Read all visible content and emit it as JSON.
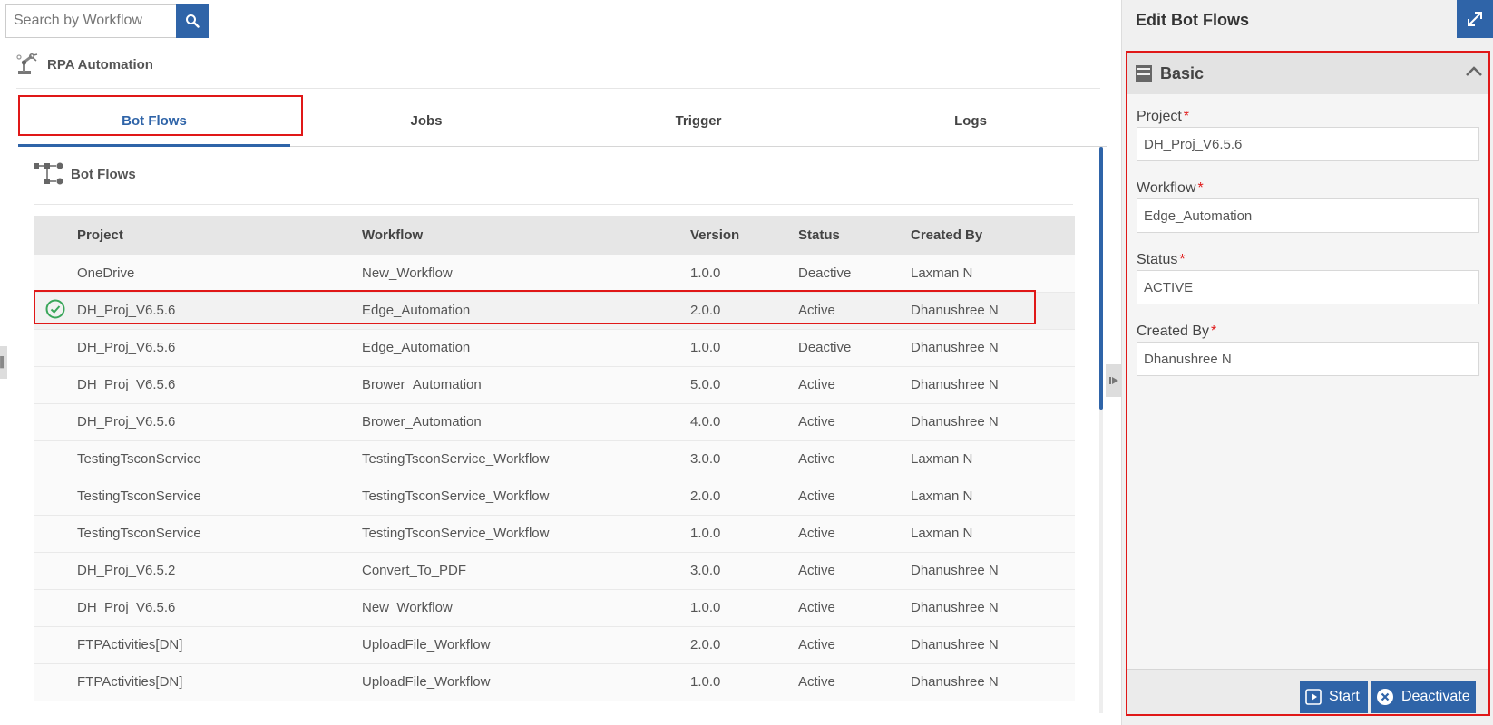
{
  "search": {
    "placeholder": "Search by Workflow"
  },
  "app": {
    "title": "RPA Automation"
  },
  "tabs": [
    {
      "label": "Bot Flows",
      "active": true
    },
    {
      "label": "Jobs"
    },
    {
      "label": "Trigger"
    },
    {
      "label": "Logs"
    }
  ],
  "section": {
    "title": "Bot Flows"
  },
  "table": {
    "headers": [
      "Project",
      "Workflow",
      "Version",
      "Status",
      "Created By"
    ],
    "rows": [
      [
        "OneDrive",
        "New_Workflow",
        "1.0.0",
        "Deactive",
        "Laxman N"
      ],
      [
        "DH_Proj_V6.5.6",
        "Edge_Automation",
        "2.0.0",
        "Active",
        "Dhanushree N"
      ],
      [
        "DH_Proj_V6.5.6",
        "Edge_Automation",
        "1.0.0",
        "Deactive",
        "Dhanushree N"
      ],
      [
        "DH_Proj_V6.5.6",
        "Brower_Automation",
        "5.0.0",
        "Active",
        "Dhanushree N"
      ],
      [
        "DH_Proj_V6.5.6",
        "Brower_Automation",
        "4.0.0",
        "Active",
        "Dhanushree N"
      ],
      [
        "TestingTsconService",
        "TestingTsconService_Workflow",
        "3.0.0",
        "Active",
        "Laxman N"
      ],
      [
        "TestingTsconService",
        "TestingTsconService_Workflow",
        "2.0.0",
        "Active",
        "Laxman N"
      ],
      [
        "TestingTsconService",
        "TestingTsconService_Workflow",
        "1.0.0",
        "Active",
        "Laxman N"
      ],
      [
        "DH_Proj_V6.5.2",
        "Convert_To_PDF",
        "3.0.0",
        "Active",
        "Dhanushree N"
      ],
      [
        "DH_Proj_V6.5.6",
        "New_Workflow",
        "1.0.0",
        "Active",
        "Dhanushree N"
      ],
      [
        "FTPActivities[DN]",
        "UploadFile_Workflow",
        "2.0.0",
        "Active",
        "Dhanushree N"
      ],
      [
        "FTPActivities[DN]",
        "UploadFile_Workflow",
        "1.0.0",
        "Active",
        "Dhanushree N"
      ]
    ],
    "selected_index": 1
  },
  "panel": {
    "title": "Edit Bot Flows",
    "section": "Basic",
    "fields": {
      "project": {
        "label": "Project",
        "value": "DH_Proj_V6.5.6"
      },
      "workflow": {
        "label": "Workflow",
        "value": "Edge_Automation"
      },
      "status": {
        "label": "Status",
        "value": "ACTIVE"
      },
      "created_by": {
        "label": "Created By",
        "value": "Dhanushree N"
      }
    },
    "start_label": "Start",
    "deactivate_label": "Deactivate"
  },
  "colors": {
    "accent": "#2f64a8",
    "highlight": "#e01818",
    "success": "#3aa65a"
  }
}
